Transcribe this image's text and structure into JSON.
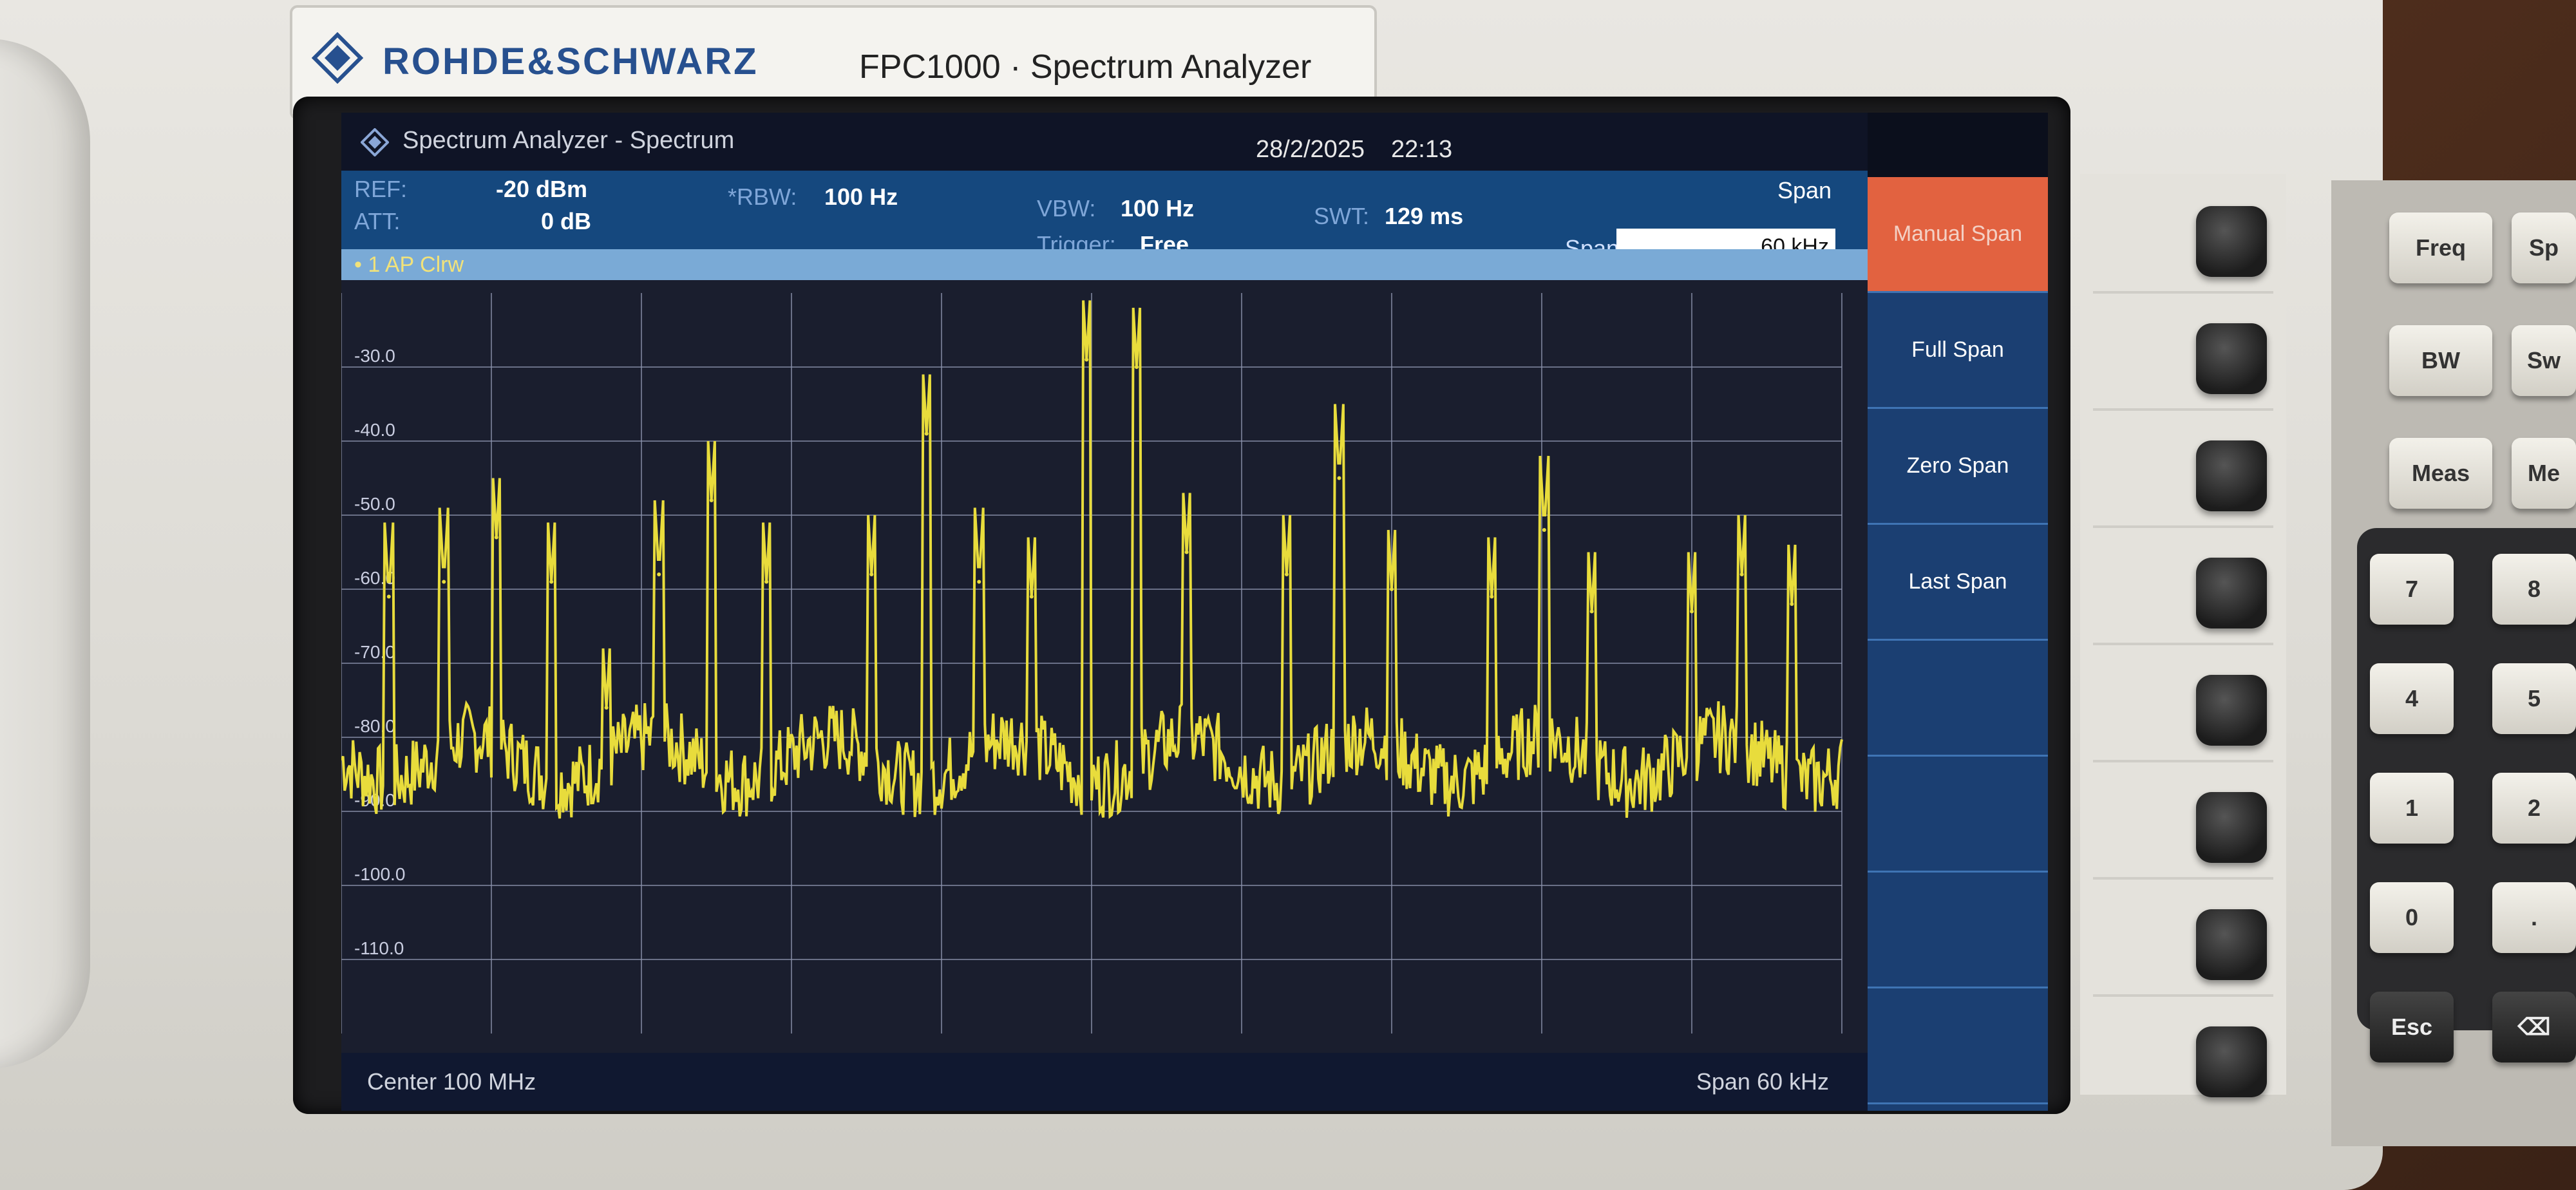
{
  "device": {
    "brand": "ROHDE&SCHWARZ",
    "model": "FPC1000 · Spectrum Analyzer"
  },
  "screen": {
    "window_title": "Spectrum Analyzer - Spectrum",
    "date": "28/2/2025",
    "time": "22:13",
    "mode": "Span",
    "ref_label": "REF:",
    "ref_value": "-20 dBm",
    "att_label": "ATT:",
    "att_value": "0 dB",
    "rbw_label": "*RBW:",
    "rbw_value": "100 Hz",
    "vbw_label": "VBW:",
    "vbw_value": "100 Hz",
    "trigger_label": "Trigger:",
    "trigger_value": "Free",
    "swt_label": "SWT:",
    "swt_value": "129 ms",
    "span_label": "Span",
    "span_input": "60 kHz",
    "trace_label": "• 1 AP Clrw",
    "footer_center": "Center 100 MHz",
    "footer_span": "Span 60 kHz"
  },
  "softkeys": [
    {
      "label": "Manual Span",
      "active": true
    },
    {
      "label": "Full Span",
      "active": false
    },
    {
      "label": "Zero Span",
      "active": false
    },
    {
      "label": "Last Span",
      "active": false
    },
    {
      "label": "",
      "active": false
    },
    {
      "label": "",
      "active": false
    },
    {
      "label": "",
      "active": false
    },
    {
      "label": "",
      "active": false
    }
  ],
  "hardkeys": [
    "Freq",
    "BW",
    "Meas"
  ],
  "hardkeys_partial": [
    "Sp",
    "Sw",
    "Me"
  ],
  "keypad": [
    "7",
    "8",
    "4",
    "5",
    "1",
    "2",
    "0",
    ".",
    "Esc",
    "⌫"
  ],
  "colors": {
    "trace": "#e8dc3c",
    "grid": "#8c93ad",
    "active_softkey": "#e26240",
    "param_bar": "#15487e"
  },
  "chart_data": {
    "type": "line",
    "title": "",
    "xlabel": "Center 100 MHz",
    "ylabel": "",
    "x_range_khz": [
      -30,
      30
    ],
    "ylim": [
      -120,
      -20
    ],
    "y_ticks": [
      -30.0,
      -40.0,
      -50.0,
      -60.0,
      -70.0,
      -80.0,
      -90.0,
      -100.0,
      -110.0
    ],
    "y_tick_labels": [
      "-30.0",
      "-40.0",
      "-50.0",
      "-60.0",
      "-70.0",
      "-80.0",
      "-90.0",
      "-100.0",
      "-110.0"
    ],
    "x_divisions": 10,
    "noise_floor_dbm": -83,
    "peaks": [
      {
        "x": -28.1,
        "y": -61
      },
      {
        "x": -25.9,
        "y": -59
      },
      {
        "x": -23.8,
        "y": -53
      },
      {
        "x": -21.6,
        "y": -59
      },
      {
        "x": -19.4,
        "y": -76
      },
      {
        "x": -17.3,
        "y": -58
      },
      {
        "x": -15.2,
        "y": -48
      },
      {
        "x": -13.0,
        "y": -59
      },
      {
        "x": -8.8,
        "y": -58
      },
      {
        "x": -6.6,
        "y": -39
      },
      {
        "x": -4.5,
        "y": -59
      },
      {
        "x": -2.4,
        "y": -61
      },
      {
        "x": -0.2,
        "y": -29
      },
      {
        "x": 1.8,
        "y": -30
      },
      {
        "x": 3.8,
        "y": -55
      },
      {
        "x": 7.8,
        "y": -58
      },
      {
        "x": 9.9,
        "y": -45
      },
      {
        "x": 12.0,
        "y": -60
      },
      {
        "x": 16.0,
        "y": -61
      },
      {
        "x": 18.1,
        "y": -52
      },
      {
        "x": 20.0,
        "y": -63
      },
      {
        "x": 24.0,
        "y": -63
      },
      {
        "x": 26.0,
        "y": -58
      },
      {
        "x": 28.0,
        "y": -62
      }
    ]
  }
}
